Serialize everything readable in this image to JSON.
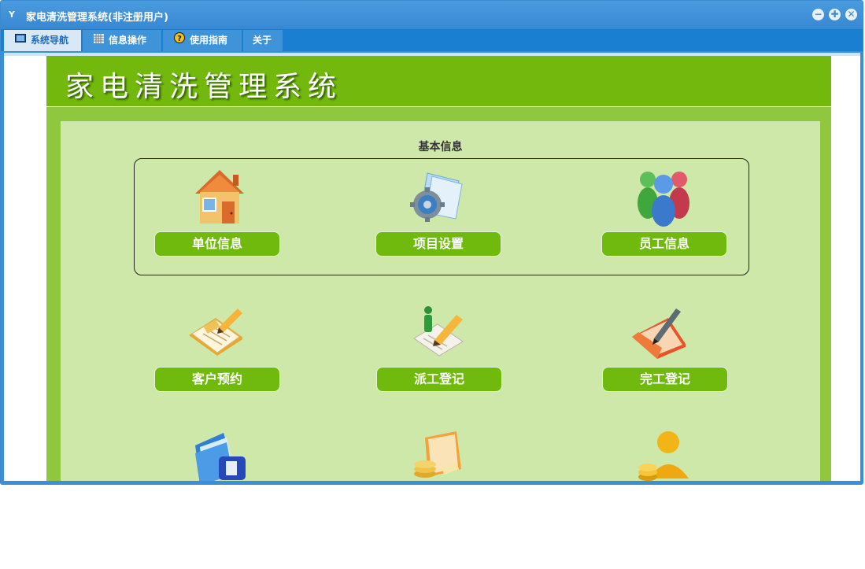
{
  "window": {
    "title": "家电清洗管理系统(非注册用户)",
    "app_icon_text": "Y"
  },
  "menu": {
    "tabs": [
      {
        "label": "系统导航",
        "active": true,
        "icon": "monitor-icon"
      },
      {
        "label": "信息操作",
        "active": false,
        "icon": "grid-icon"
      },
      {
        "label": "使用指南",
        "active": false,
        "icon": "help-icon"
      },
      {
        "label": "关于",
        "active": false,
        "icon": ""
      }
    ]
  },
  "banner": {
    "title": "家电清洗管理系统"
  },
  "section": {
    "title": "基本信息"
  },
  "items": [
    {
      "label": "单位信息",
      "icon": "house-icon"
    },
    {
      "label": "项目设置",
      "icon": "settings-folder-icon"
    },
    {
      "label": "员工信息",
      "icon": "users-icon"
    },
    {
      "label": "客户预约",
      "icon": "clipboard-pencil-icon"
    },
    {
      "label": "派工登记",
      "icon": "dispatch-document-icon"
    },
    {
      "label": "完工登记",
      "icon": "folder-pen-icon"
    },
    {
      "label": "",
      "icon": "blue-folder-icon"
    },
    {
      "label": "",
      "icon": "money-folder-icon"
    },
    {
      "label": "",
      "icon": "gold-user-coins-icon"
    }
  ],
  "colors": {
    "titlebar": "#3b8fd6",
    "banner": "#72b80d",
    "panel": "#8fc83f",
    "inner": "#cde8a9",
    "button": "#6fba0d"
  }
}
